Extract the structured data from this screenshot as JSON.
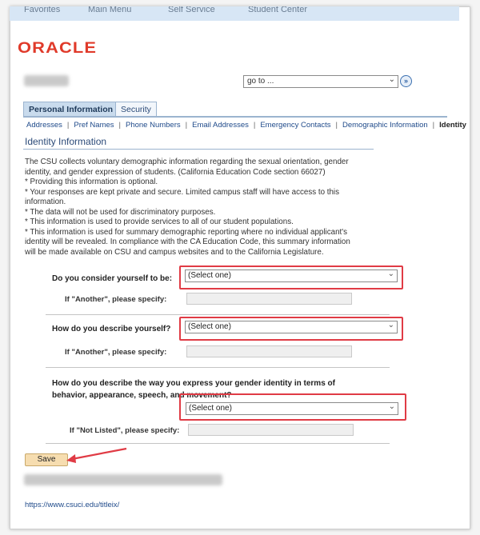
{
  "top_nav": {
    "items": [
      "Favorites",
      "Main Menu",
      "Self Service",
      "Student Center"
    ]
  },
  "logo": {
    "text": "ORACLE"
  },
  "goto": {
    "value": "go to ...",
    "button_icon": "double-chevron-right-icon"
  },
  "tabs": [
    {
      "label": "Personal Information",
      "active": true
    },
    {
      "label": "Security",
      "active": false
    }
  ],
  "subnav": {
    "links": [
      "Addresses",
      "Pref Names",
      "Phone Numbers",
      "Email Addresses",
      "Emergency Contacts",
      "Demographic Information"
    ],
    "current": "Identity"
  },
  "section": {
    "title": "Identity Information"
  },
  "intro_lines": [
    "The CSU collects voluntary demographic information regarding the sexual orientation, gender",
    "identity, and gender expression of students. (California Education Code section 66027)",
    "* Providing this information is optional.",
    "* Your responses are kept private and secure. Limited campus staff will have access to this",
    "information.",
    "* The data will not be used for discriminatory purposes.",
    "* This information is used to provide services to all of our student populations.",
    "* This information is used for summary demographic reporting where no individual applicant's",
    "identity will be revealed. In compliance with the CA Education Code, this summary information",
    "will be made available on CSU and campus websites and to the California Legislature."
  ],
  "questions": {
    "q1": {
      "label": "Do you consider yourself to be:",
      "value": "(Select one)",
      "specify_label": "If \"Another\", please specify:",
      "specify_value": ""
    },
    "q2": {
      "label": "How do you describe yourself?",
      "value": "(Select one)",
      "specify_label": "If \"Another\", please specify:",
      "specify_value": ""
    },
    "q3": {
      "label_line1": "How do you describe the way you express your gender identity in terms of",
      "label_line2": "behavior, appearance, speech, and movement?",
      "value": "(Select one)",
      "specify_label": "If \"Not Listed\", please specify:",
      "specify_value": ""
    }
  },
  "save_label": "Save",
  "footer_link": "https://www.csuci.edu/titleix/",
  "colors": {
    "highlight": "#e03b45",
    "oracle_red": "#e03a2a",
    "link": "#1f4a8a"
  }
}
